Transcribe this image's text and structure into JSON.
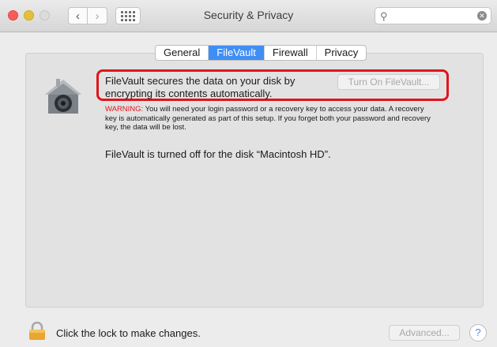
{
  "window": {
    "title": "Security & Privacy",
    "search_placeholder": ""
  },
  "nav": {
    "back_glyph": "‹",
    "forward_glyph": "›"
  },
  "tabs": [
    {
      "label": "General",
      "active": false
    },
    {
      "label": "FileVault",
      "active": true
    },
    {
      "label": "Firewall",
      "active": false
    },
    {
      "label": "Privacy",
      "active": false
    }
  ],
  "filevault": {
    "description": "FileVault secures the data on your disk by encrypting its contents automatically.",
    "turn_on_label": "Turn On FileVault...",
    "warning_label": "WARNING:",
    "warning_text": " You will need your login password or a recovery key to access your data. A recovery key is automatically generated as part of this setup. If you forget both your password and recovery key, the data will be lost.",
    "status": "FileVault is turned off for the disk “Macintosh HD”."
  },
  "footer": {
    "lock_text": "Click the lock to make changes.",
    "advanced_label": "Advanced...",
    "help_label": "?"
  },
  "colors": {
    "accent": "#3f8ef5",
    "highlight": "#e0151b",
    "warning": "#e0151b"
  }
}
